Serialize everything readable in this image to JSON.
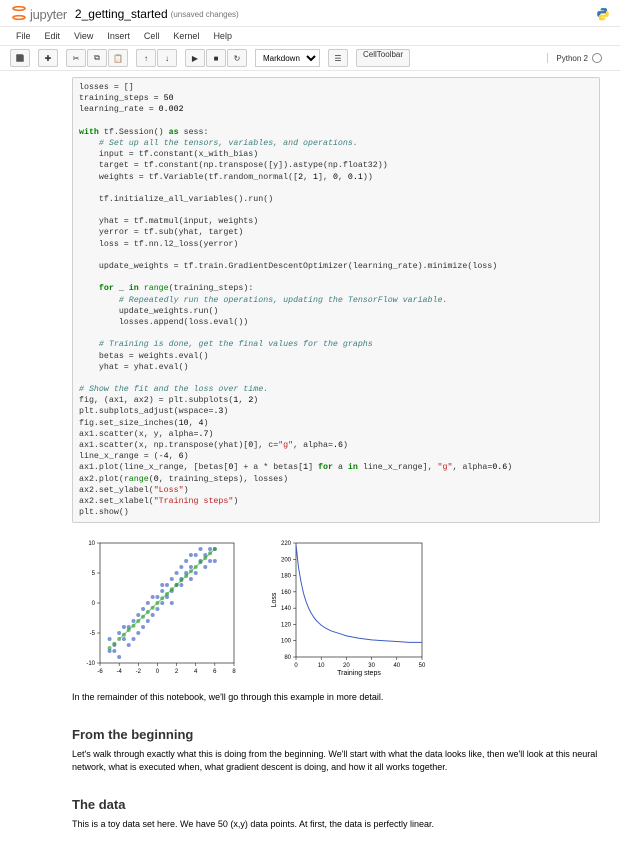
{
  "header": {
    "logo_text": "jupyter",
    "title": "2_getting_started",
    "status": "(unsaved changes)"
  },
  "menubar": [
    "File",
    "Edit",
    "View",
    "Insert",
    "Cell",
    "Kernel",
    "Help"
  ],
  "toolbar": {
    "cell_type": "Markdown",
    "celltoolbar": "CellToolbar"
  },
  "kernel": {
    "name": "Python 2"
  },
  "code": {
    "l01a": "losses = []",
    "l01": "training_steps = ",
    "l01n": "50",
    "l02": "learning_rate = ",
    "l02n": "0.002",
    "l03a": "with",
    "l03b": " tf.Session() ",
    "l03c": "as",
    "l03d": " sess:",
    "l04": "    # Set up all the tensors, variables, and operations.",
    "l05": "    input = tf.constant(x_with_bias)",
    "l06": "    target = tf.constant(np.transpose([y]).astype(np.float32))",
    "l07a": "    weights = tf.Variable(tf.random_normal([",
    "l07b": "2",
    "l07c": ", ",
    "l07d": "1",
    "l07e": "], ",
    "l07f": "0",
    "l07g": ", ",
    "l07h": "0.1",
    "l07i": "))",
    "l08": "    tf.initialize_all_variables().run()",
    "l09": "    yhat = tf.matmul(input, weights)",
    "l10": "    yerror = tf.sub(yhat, target)",
    "l11": "    loss = tf.nn.l2_loss(yerror)",
    "l12": "    update_weights = tf.train.GradientDescentOptimizer(learning_rate).minimize(loss)",
    "l13a": "    for",
    "l13b": " _ ",
    "l13c": "in",
    "l13d": " ",
    "l13e": "range",
    "l13f": "(training_steps):",
    "l14": "        # Repeatedly run the operations, updating the TensorFlow variable.",
    "l15": "        update_weights.run()",
    "l16": "        losses.append(loss.eval())",
    "l17": "    # Training is done, get the final values for the graphs",
    "l18": "    betas = weights.eval()",
    "l19": "    yhat = yhat.eval()",
    "l20": "# Show the fit and the loss over time.",
    "l21a": "fig, (ax1, ax2) = plt.subplots(",
    "l21b": "1",
    "l21c": ", ",
    "l21d": "2",
    "l21e": ")",
    "l22a": "plt.subplots_adjust(wspace=",
    "l22b": ".3",
    "l22c": ")",
    "l23a": "fig.set_size_inches(",
    "l23b": "10",
    "l23c": ", ",
    "l23d": "4",
    "l23e": ")",
    "l24a": "ax1.scatter(x, y, alpha=",
    "l24b": ".7",
    "l24c": ")",
    "l25a": "ax1.scatter(x, np.transpose(yhat)[",
    "l25b": "0",
    "l25c": "], c=",
    "l25d": "\"g\"",
    "l25e": ", alpha=",
    "l25f": ".6",
    "l25g": ")",
    "l26a": "line_x_range = (-",
    "l26b": "4",
    "l26c": ", ",
    "l26d": "6",
    "l26e": ")",
    "l27a": "ax1.plot(line_x_range, [betas[",
    "l27b": "0",
    "l27c": "] + a * betas[",
    "l27d": "1",
    "l27e": "] ",
    "l27f": "for",
    "l27g": " a ",
    "l27h": "in",
    "l27i": " line_x_range], ",
    "l27j": "\"g\"",
    "l27k": ", alpha=",
    "l27l": "0.6",
    "l27m": ")",
    "l28a": "ax2.plot(",
    "l28b": "range",
    "l28c": "(",
    "l28d": "0",
    "l28e": ", training_steps), losses)",
    "l29a": "ax2.set_ylabel(",
    "l29b": "\"Loss\"",
    "l29c": ")",
    "l30a": "ax2.set_xlabel(",
    "l30b": "\"Training steps\"",
    "l30c": ")",
    "l31": "plt.show()"
  },
  "markdown": {
    "p1": "In the remainder of this notebook, we'll go through this example in more detail.",
    "h1": "From the beginning",
    "p2": "Let's walk through exactly what this is doing from the beginning. We'll start with what the data looks like, then we'll look at this neural network, what is executed when, what gradient descent is doing, and how it all works together.",
    "h2": "The data",
    "p3": "This is a toy data set here. We have 50 (x,y) data points. At first, the data is perfectly linear."
  },
  "chart_data": [
    {
      "type": "scatter",
      "title": "",
      "xlabel": "",
      "ylabel": "",
      "xlim": [
        -6,
        8
      ],
      "ylim": [
        -10,
        10
      ],
      "xticks": [
        -6,
        -4,
        -2,
        0,
        2,
        4,
        6,
        8
      ],
      "yticks": [
        -10,
        -5,
        0,
        5,
        10
      ],
      "series": [
        {
          "name": "data",
          "color": "#3b5cc4",
          "points": [
            [
              -5,
              -8
            ],
            [
              -4.5,
              -7
            ],
            [
              -4,
              -9
            ],
            [
              -4,
              -5
            ],
            [
              -3.5,
              -6
            ],
            [
              -3,
              -4
            ],
            [
              -3,
              -7
            ],
            [
              -2.5,
              -3
            ],
            [
              -2,
              -2
            ],
            [
              -2,
              -5
            ],
            [
              -1.5,
              -1
            ],
            [
              -1,
              -3
            ],
            [
              -1,
              0
            ],
            [
              -0.5,
              1
            ],
            [
              -0.5,
              -2
            ],
            [
              0,
              1
            ],
            [
              0,
              -1
            ],
            [
              0.5,
              2
            ],
            [
              0.5,
              0
            ],
            [
              1,
              3
            ],
            [
              1,
              1
            ],
            [
              1.5,
              4
            ],
            [
              1.5,
              2
            ],
            [
              2,
              3
            ],
            [
              2,
              5
            ],
            [
              2.5,
              6
            ],
            [
              2.5,
              3
            ],
            [
              3,
              5
            ],
            [
              3,
              7
            ],
            [
              3.5,
              6
            ],
            [
              3.5,
              4
            ],
            [
              4,
              8
            ],
            [
              4,
              5
            ],
            [
              4.5,
              7
            ],
            [
              4.5,
              9
            ],
            [
              5,
              8
            ],
            [
              5,
              6
            ],
            [
              -3.5,
              -4
            ],
            [
              -2.5,
              -6
            ],
            [
              -1.5,
              -4
            ],
            [
              0.5,
              3
            ],
            [
              1.5,
              0
            ],
            [
              2.5,
              4
            ],
            [
              3.5,
              8
            ],
            [
              -5,
              -6
            ],
            [
              -4.5,
              -8
            ],
            [
              5.5,
              7
            ],
            [
              5.5,
              9
            ],
            [
              6,
              9
            ],
            [
              6,
              7
            ]
          ]
        },
        {
          "name": "yhat",
          "color": "#2ca02c",
          "points": [
            [
              -5,
              -7.5
            ],
            [
              -4.5,
              -6.8
            ],
            [
              -4,
              -6
            ],
            [
              -3.5,
              -5.3
            ],
            [
              -3,
              -4.5
            ],
            [
              -2.5,
              -3.8
            ],
            [
              -2,
              -3
            ],
            [
              -1.5,
              -2.3
            ],
            [
              -1,
              -1.5
            ],
            [
              -0.5,
              -0.8
            ],
            [
              0,
              0
            ],
            [
              0.5,
              0.8
            ],
            [
              1,
              1.5
            ],
            [
              1.5,
              2.3
            ],
            [
              2,
              3
            ],
            [
              2.5,
              3.8
            ],
            [
              3,
              4.5
            ],
            [
              3.5,
              5.3
            ],
            [
              4,
              6
            ],
            [
              4.5,
              6.8
            ],
            [
              5,
              7.5
            ],
            [
              5.5,
              8.3
            ],
            [
              6,
              9
            ]
          ]
        }
      ],
      "fit_line": {
        "x": [
          -4,
          6
        ],
        "y": [
          -6,
          9
        ],
        "color": "#2ca02c"
      }
    },
    {
      "type": "line",
      "title": "",
      "xlabel": "Training steps",
      "ylabel": "Loss",
      "xlim": [
        0,
        50
      ],
      "ylim": [
        80,
        220
      ],
      "xticks": [
        0,
        10,
        20,
        30,
        40,
        50
      ],
      "yticks": [
        80,
        100,
        120,
        140,
        160,
        180,
        200,
        220
      ],
      "series": [
        {
          "name": "loss",
          "color": "#3b5cc4",
          "x": [
            0,
            1,
            2,
            3,
            4,
            5,
            6,
            7,
            8,
            9,
            10,
            12,
            14,
            16,
            18,
            20,
            25,
            30,
            35,
            40,
            45,
            50
          ],
          "y": [
            218,
            190,
            172,
            158,
            148,
            140,
            134,
            129,
            125,
            122,
            119,
            115,
            112,
            110,
            108,
            106,
            103,
            101,
            100,
            99,
            98,
            98
          ]
        }
      ]
    }
  ]
}
